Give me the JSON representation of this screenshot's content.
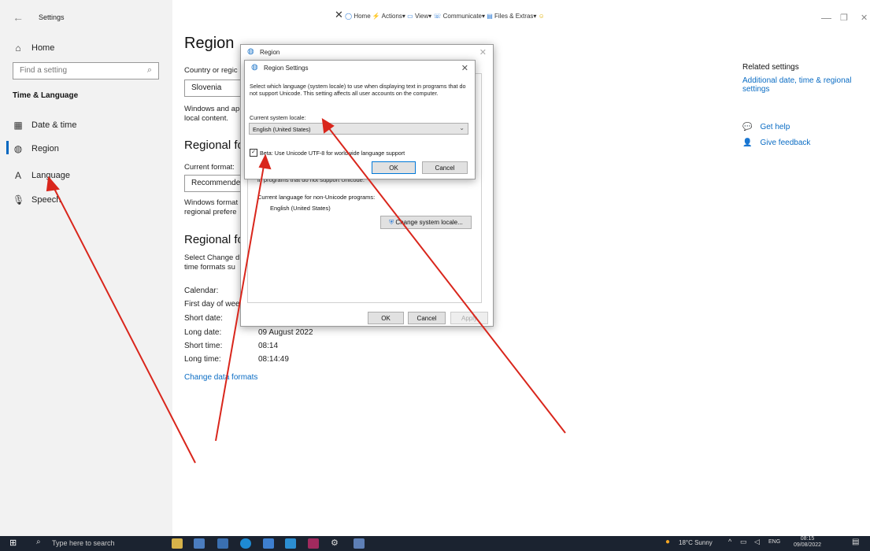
{
  "window": {
    "title": "Settings",
    "back_glyph": "←",
    "minimize_glyph": "—",
    "restore_glyph": "❐",
    "close_glyph": "✕"
  },
  "toolbar": {
    "close_glyph": "✕",
    "items": [
      "Home",
      "Actions",
      "View",
      "Communicate",
      "Files & Extras"
    ]
  },
  "sidebar": {
    "home": {
      "icon": "home-icon",
      "label": "Home"
    },
    "search_placeholder": "Find a setting",
    "section": "Time & Language",
    "items": [
      {
        "icon": "date-time-icon",
        "label": "Date & time"
      },
      {
        "icon": "globe-icon",
        "label": "Region"
      },
      {
        "icon": "language-icon",
        "label": "Language"
      },
      {
        "icon": "microphone-icon",
        "label": "Speech"
      }
    ]
  },
  "main": {
    "title": "Region",
    "country_label": "Country or regic",
    "country_value": "Slovenia",
    "windows_text_1": "Windows and ap",
    "windows_text_2": "local content.",
    "regional_format_heading": "Regional for",
    "current_format_label": "Current format:",
    "current_format_value": "Recommendec",
    "format_text_1": "Windows format",
    "format_text_2": "regional prefere",
    "regional_format_data_heading": "Regional for",
    "select_change_1": "Select Change d",
    "select_change_2": "time formats su",
    "rows": [
      {
        "label": "Calendar:",
        "value": ""
      },
      {
        "label": "First day of wee",
        "value": ""
      },
      {
        "label": "Short date:",
        "value": ""
      },
      {
        "label": "Long date:",
        "value": "09 August 2022"
      },
      {
        "label": "Short time:",
        "value": "08:14"
      },
      {
        "label": "Long time:",
        "value": "08:14:49"
      }
    ],
    "change_link": "Change data formats"
  },
  "related": {
    "heading": "Related settings",
    "link_line1": "Additional date, time & regional",
    "link_line2": "settings",
    "help": "Get help",
    "feedback": "Give feedback"
  },
  "region_dialog": {
    "title": "Region",
    "partial_text": "in programs that do not support Unicode.",
    "current_lang_label": "Current language for non-Unicode programs:",
    "current_lang_value": "English (United States)",
    "change_locale_button": "Change system locale...",
    "ok": "OK",
    "cancel": "Cancel",
    "apply": "Apply"
  },
  "region_settings_dialog": {
    "title": "Region Settings",
    "description": "Select which language (system locale) to use when displaying text in programs that do not support Unicode. This setting affects all user accounts on the computer.",
    "locale_label": "Current system locale:",
    "locale_value": "English (United States)",
    "beta_label": "Beta: Use Unicode UTF-8 for worldwide language support",
    "beta_checked": true,
    "ok": "OK",
    "cancel": "Cancel"
  },
  "taskbar": {
    "search_placeholder": "Type here to search",
    "weather": "18°C  Sunny",
    "lang": "ENG",
    "time": "08:15",
    "date": "09/08/2022"
  },
  "colors": {
    "accent": "#0067c0",
    "arrow": "#d9261c",
    "taskbar": "#1b2330"
  }
}
